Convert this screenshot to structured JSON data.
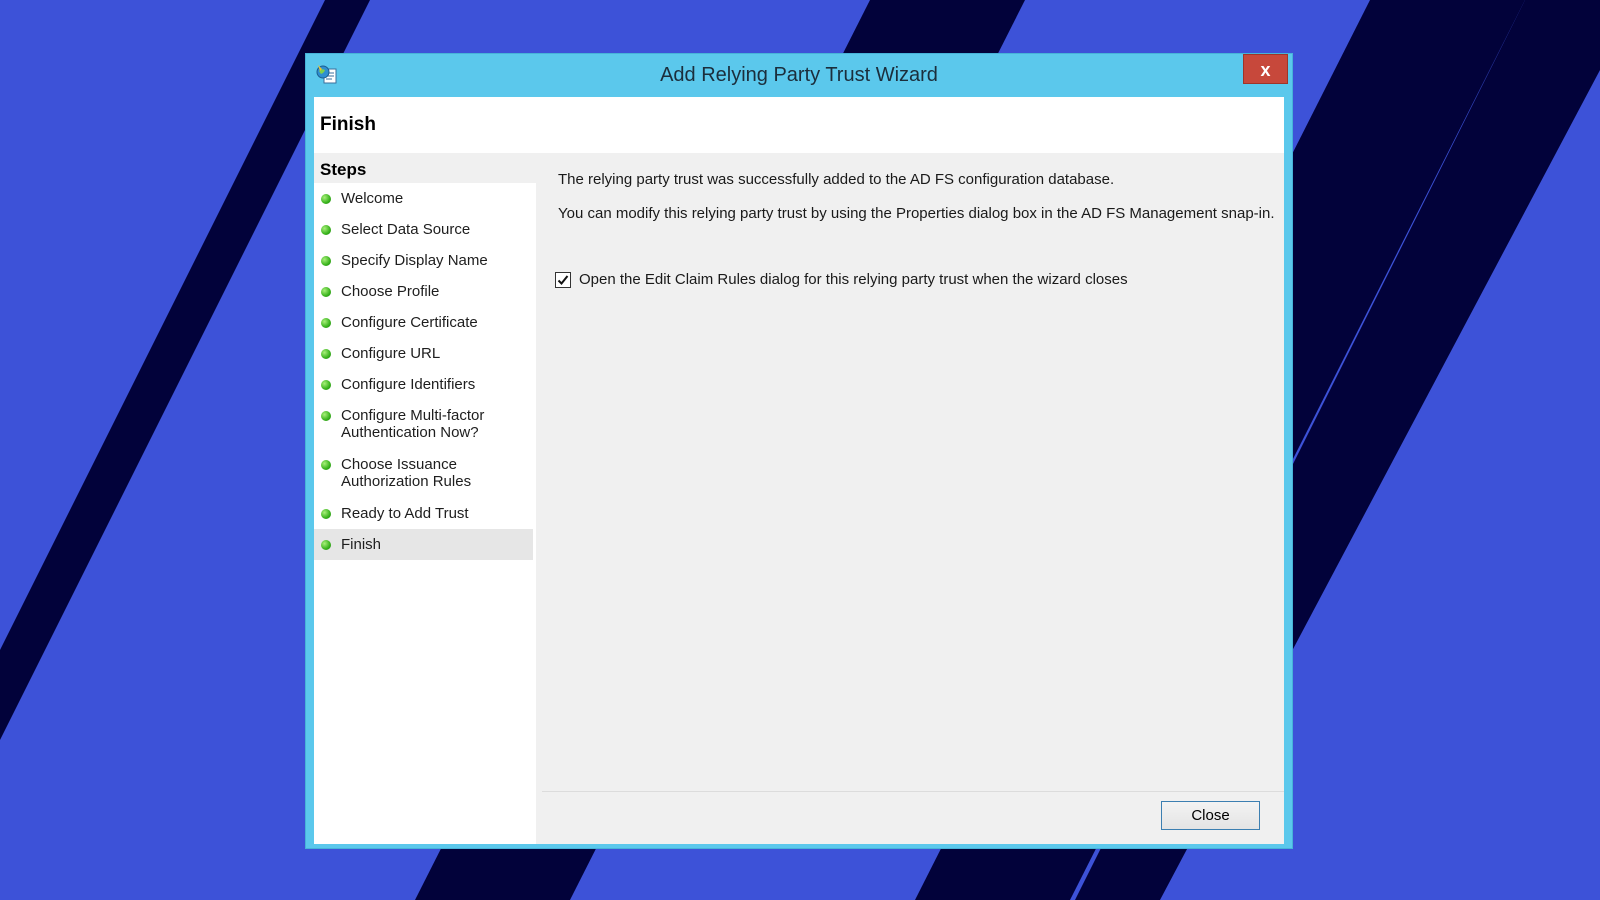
{
  "window": {
    "title": "Add Relying Party Trust Wizard",
    "close_glyph": "x"
  },
  "header": {
    "title": "Finish"
  },
  "steps": {
    "heading": "Steps",
    "items": [
      {
        "label": "Welcome"
      },
      {
        "label": "Select Data Source"
      },
      {
        "label": "Specify Display Name"
      },
      {
        "label": "Choose Profile"
      },
      {
        "label": "Configure Certificate"
      },
      {
        "label": "Configure URL"
      },
      {
        "label": "Configure Identifiers"
      },
      {
        "label_line1": "Configure Multi-factor",
        "label_line2": "Authentication Now?"
      },
      {
        "label_line1": "Choose Issuance",
        "label_line2": "Authorization Rules"
      },
      {
        "label": "Ready to Add Trust"
      },
      {
        "label": "Finish"
      }
    ]
  },
  "content": {
    "message1": "The relying party trust was successfully added to the AD FS configuration database.",
    "message2": "You can modify this relying party trust by using the Properties dialog box in the AD FS Management snap-in.",
    "checkbox_label": "Open the Edit Claim Rules dialog for this relying party trust when the wizard closes",
    "checkbox_checked": true
  },
  "footer": {
    "close_label": "Close"
  },
  "colors": {
    "background": "#3d52d8",
    "stripe": "#02023a",
    "titlebar": "#5bc8ec",
    "close_red": "#c7483b",
    "step_dot": "#37b21b"
  },
  "icons": {
    "app": "adfs-wizard-icon",
    "step_status": "green-dot-icon",
    "check": "checkmark-icon"
  }
}
